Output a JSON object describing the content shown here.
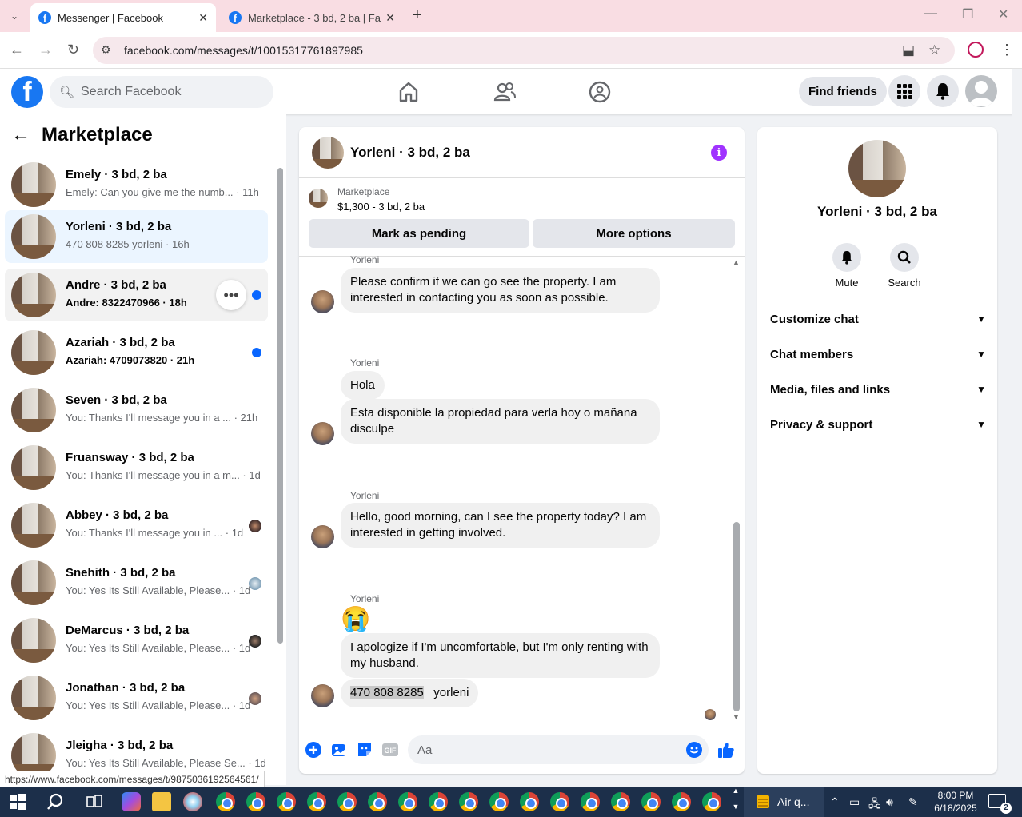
{
  "browser": {
    "tabs": [
      {
        "title": "Messenger | Facebook",
        "active": true
      },
      {
        "title": "Marketplace - 3 bd, 2 ba | Facebook",
        "active": false
      }
    ],
    "url": "facebook.com/messages/t/10015317761897985",
    "status_url": "https://www.facebook.com/messages/t/9875036192564561/"
  },
  "fb": {
    "search_placeholder": "Search Facebook",
    "find_friends": "Find friends"
  },
  "left": {
    "title": "Marketplace",
    "conversations": [
      {
        "name": "Emely · 3 bd, 2 ba",
        "preview": "Emely: Can you give me the numb... · 11h",
        "unread": false
      },
      {
        "name": "Yorleni · 3 bd, 2 ba",
        "preview": "470 808 8285 yorleni · 16h",
        "unread": false
      },
      {
        "name": "Andre · 3 bd, 2 ba",
        "preview": "Andre: 8322470966 · 18h",
        "unread": true
      },
      {
        "name": "Azariah · 3 bd, 2 ba",
        "preview": "Azariah: 4709073820 · 21h",
        "unread": true
      },
      {
        "name": "Seven · 3 bd, 2 ba",
        "preview": "You: Thanks I'll message you in a ... · 21h",
        "unread": false
      },
      {
        "name": "Fruansway · 3 bd, 2 ba",
        "preview": "You: Thanks I'll message you in a m... · 1d",
        "unread": false
      },
      {
        "name": "Abbey · 3 bd, 2 ba",
        "preview": "You: Thanks I'll message you in ... · 1d",
        "unread": false
      },
      {
        "name": "Snehith · 3 bd, 2 ba",
        "preview": "You: Yes Its Still Available, Please... · 1d",
        "unread": false
      },
      {
        "name": "DeMarcus · 3 bd, 2 ba",
        "preview": "You: Yes Its Still Available, Please... · 1d",
        "unread": false
      },
      {
        "name": "Jonathan · 3 bd, 2 ba",
        "preview": "You: Yes Its Still Available, Please... · 1d",
        "unread": false
      },
      {
        "name": "Jleigha · 3 bd, 2 ba",
        "preview": "You: Yes Its Still Available, Please Se... · 1d",
        "unread": false
      }
    ]
  },
  "chat": {
    "title": "Yorleni · 3 bd, 2 ba",
    "listing_label": "Marketplace",
    "listing_price": "$1,300 - 3 bd, 2 ba",
    "mark_pending": "Mark as pending",
    "more_options": "More options",
    "sender": "Yorleni",
    "messages": [
      "Please confirm if we can go see the property. I am interested in contacting you as soon as possible.",
      "Hola",
      "Esta disponible  la propiedad  para verla hoy o mañana disculpe",
      "Hello, good morning, can I see the property today? I am interested in getting involved.",
      "😭",
      "I apologize if I'm uncomfortable, but I'm only renting with my husband."
    ],
    "last_phone": "470 808 8285",
    "last_name": "yorleni",
    "composer_placeholder": "Aa"
  },
  "right": {
    "name": "Yorleni · 3 bd, 2 ba",
    "mute": "Mute",
    "search": "Search",
    "sections": [
      "Customize chat",
      "Chat members",
      "Media, files and links",
      "Privacy & support"
    ]
  },
  "taskbar": {
    "weather": "Air q...",
    "time": "8:00 PM",
    "date": "6/18/2025",
    "notif_count": "2"
  }
}
